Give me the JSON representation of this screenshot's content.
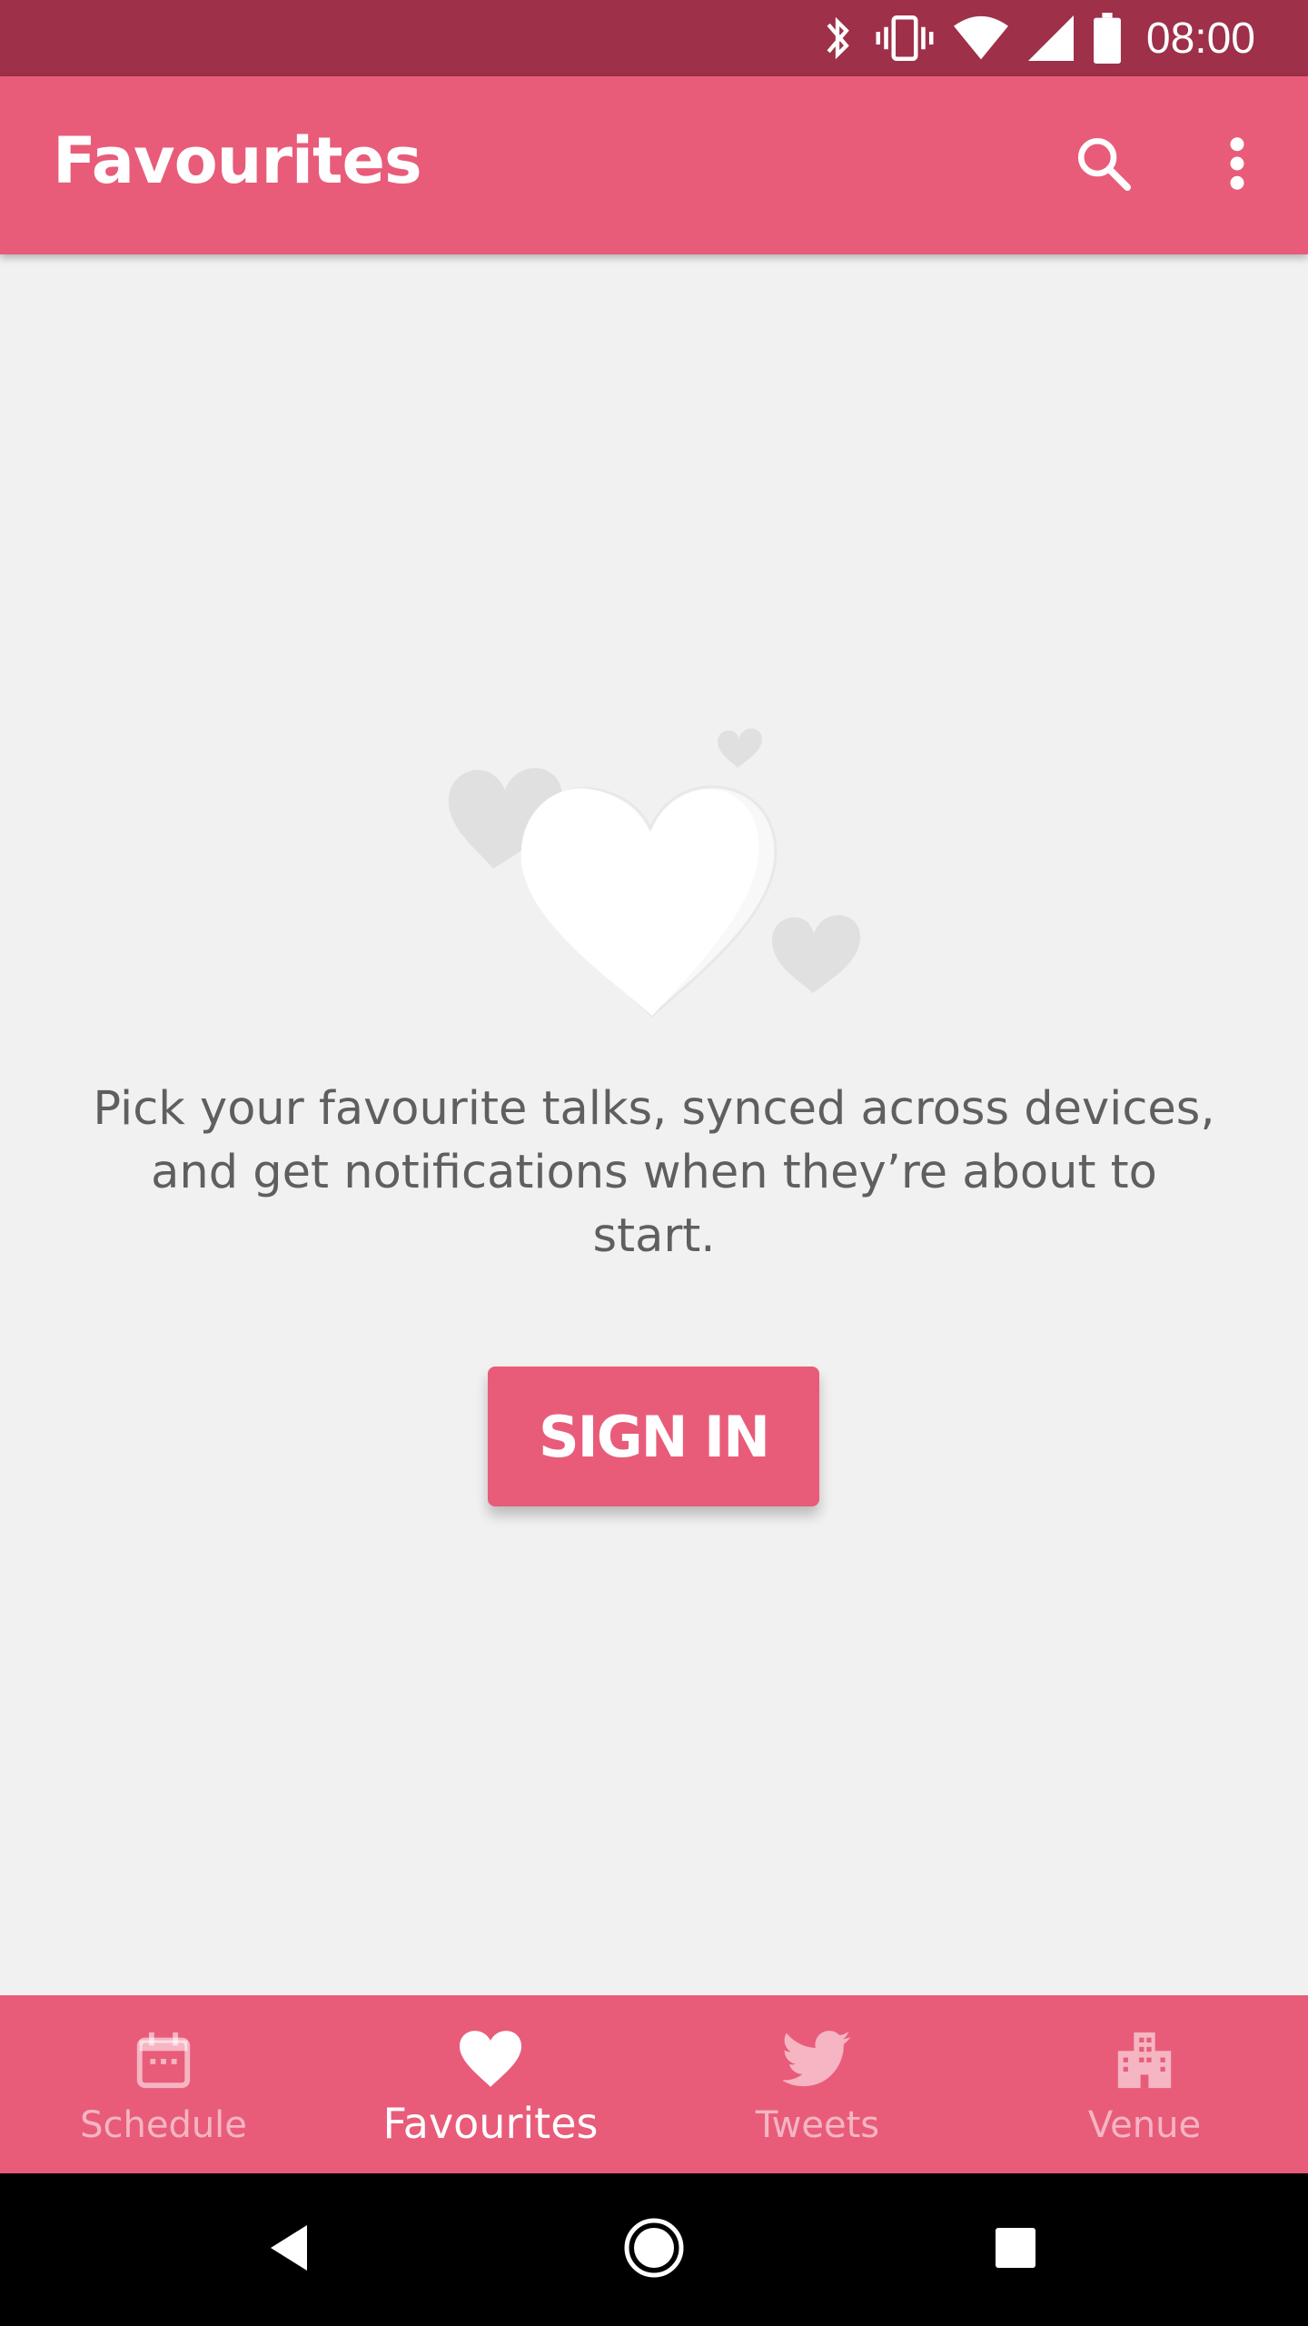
{
  "status_bar": {
    "time": "08:00",
    "icons": [
      "bluetooth-icon",
      "vibrate-icon",
      "wifi-icon",
      "cell-signal-icon",
      "battery-icon"
    ]
  },
  "app_bar": {
    "title": "Favourites",
    "actions": [
      "search-icon",
      "more-vert-icon"
    ]
  },
  "empty_state": {
    "message": "Pick your favourite talks, synced across devices, and get notifications when they’re about to start.",
    "sign_in_label": "SIGN IN"
  },
  "bottom_nav": {
    "items": [
      {
        "label": "Schedule",
        "icon": "calendar-icon",
        "active": false
      },
      {
        "label": "Favourites",
        "icon": "heart-icon",
        "active": true
      },
      {
        "label": "Tweets",
        "icon": "twitter-bird-icon",
        "active": false
      },
      {
        "label": "Venue",
        "icon": "building-icon",
        "active": false
      }
    ]
  },
  "system_nav": [
    "back-icon",
    "home-icon",
    "recents-icon"
  ],
  "colors": {
    "status_bar": "#9e3049",
    "primary": "#e85c7a",
    "background": "#f1f1f1",
    "text": "#5f5f5f"
  }
}
